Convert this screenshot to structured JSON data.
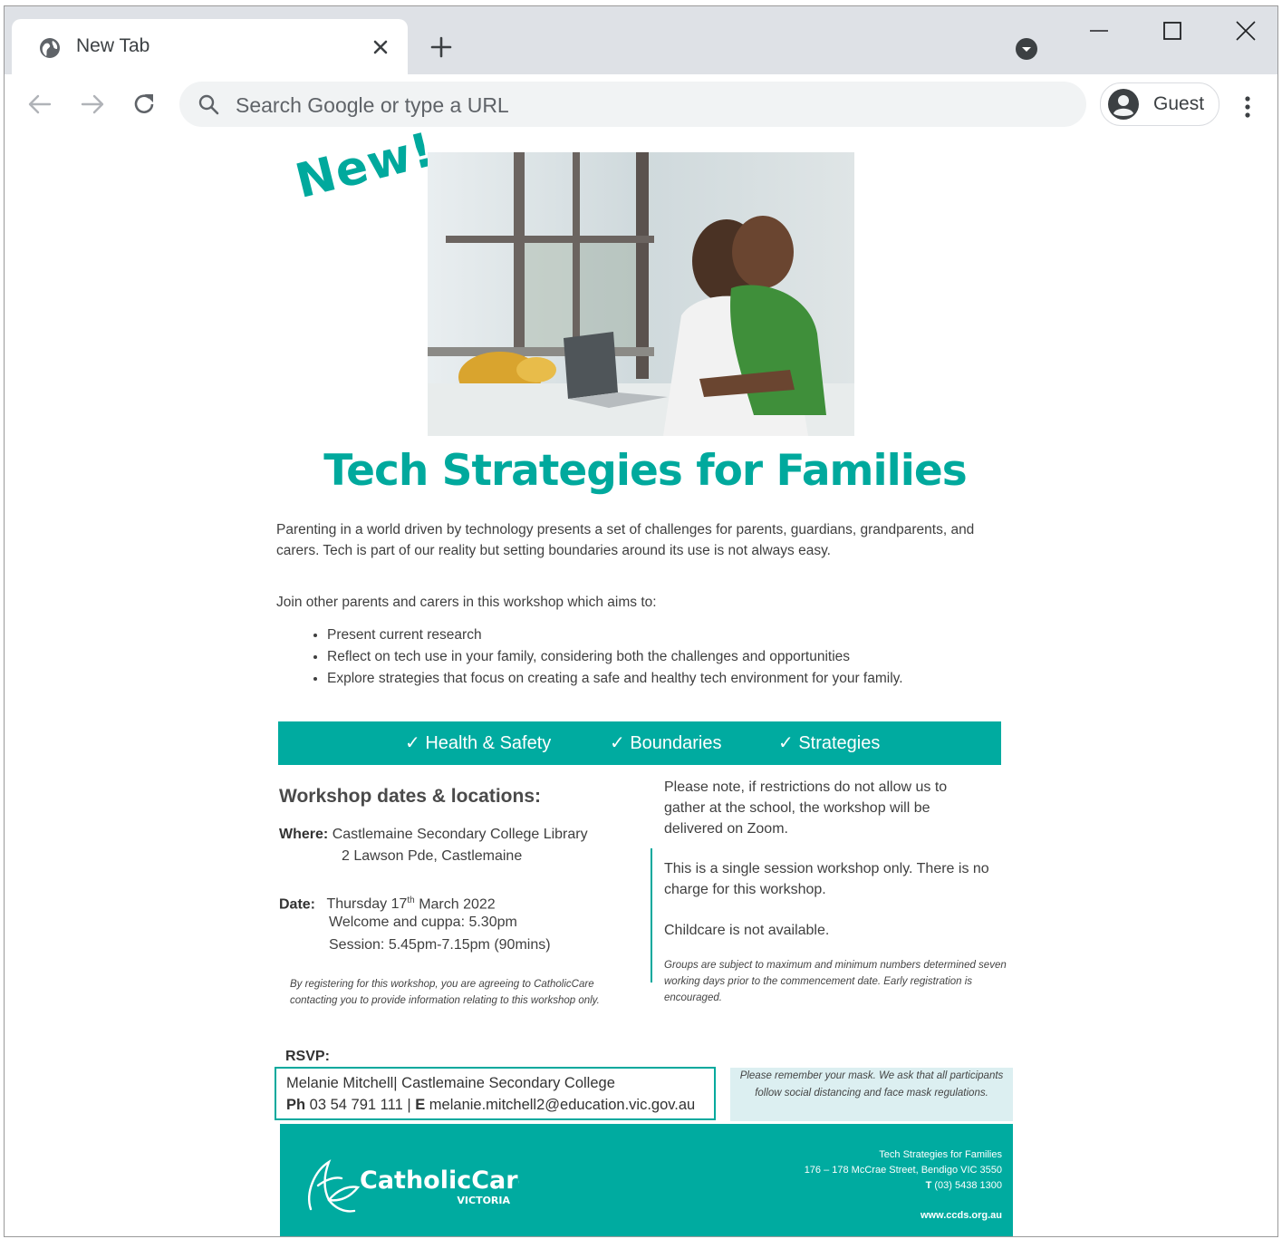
{
  "browser": {
    "tab_title": "New Tab",
    "omnibox_placeholder": "Search Google or type a URL",
    "profile_name": "Guest"
  },
  "flyer": {
    "badge": "New!",
    "headline": "Tech Strategies for Families",
    "intro": "Parenting in a world driven by technology presents a set of challenges for parents, guardians, grandparents, and carers. Tech is part of our reality but setting boundaries around its use is not always easy.",
    "join": "Join other parents and carers in this workshop which aims to:",
    "bullets": [
      "Present current research",
      "Reflect on tech use in your family, considering both the challenges and opportunities",
      "Explore strategies that focus on creating a safe and healthy tech environment for your family."
    ],
    "banner": [
      "✓ Health & Safety",
      "✓ Boundaries",
      "✓ Strategies"
    ],
    "workshop_title": "Workshop dates & locations:",
    "where_label": "Where:",
    "where_line1": "Castlemaine Secondary College Library",
    "where_line2": "2 Lawson Pde, Castlemaine",
    "date_label": "Date:",
    "date_day_prefix": "Thursday 17",
    "date_sup": "th",
    "date_day_suffix": " March 2022",
    "welcome": "Welcome and cuppa: 5.30pm",
    "session": "Session: 5.45pm-7.15pm (90mins)",
    "consent": "By registering for this workshop, you are agreeing to CatholicCare contacting you to provide information relating to this workshop only.",
    "note_restrictions": "Please note, if restrictions do not allow us to gather at the school, the workshop will be delivered on Zoom.",
    "note_single": "This is a single session workshop only. There is no charge for this workshop.",
    "note_childcare": "Childcare is not available.",
    "note_groups": "Groups are subject to maximum and minimum numbers determined seven working days prior to the commencement date. Early registration is encouraged.",
    "rsvp_label": "RSVP:",
    "rsvp_name": "Melanie Mitchell| Castlemaine Secondary College",
    "rsvp_ph_label": "Ph",
    "rsvp_phone": " 03 54 791 111 | ",
    "rsvp_email_label": "E",
    "rsvp_email": " melanie.mitchell2@education.vic.gov.au",
    "mask_note": "Please remember your mask. We ask that all participants follow social distancing and face mask regulations.",
    "footer_logo_main": "CatholicCare",
    "footer_logo_sub": "VICTORIA",
    "footer_title": "Tech Strategies for Families",
    "footer_address": "176 – 178 McCrae Street, Bendigo VIC 3550",
    "footer_phone_label": "T",
    "footer_phone": " (03) 5438 1300",
    "footer_web": "www.ccds.org.au"
  },
  "colors": {
    "accent": "#00a99d",
    "mask_bg": "#dceff1",
    "chrome_bg": "#dee1e6"
  },
  "icons": [
    "globe-icon",
    "close-icon",
    "plus-icon",
    "tab-search-icon",
    "minimize-icon",
    "maximize-icon",
    "window-close-icon",
    "back-arrow-icon",
    "forward-arrow-icon",
    "reload-icon",
    "search-icon",
    "avatar-icon",
    "kebab-menu-icon"
  ]
}
